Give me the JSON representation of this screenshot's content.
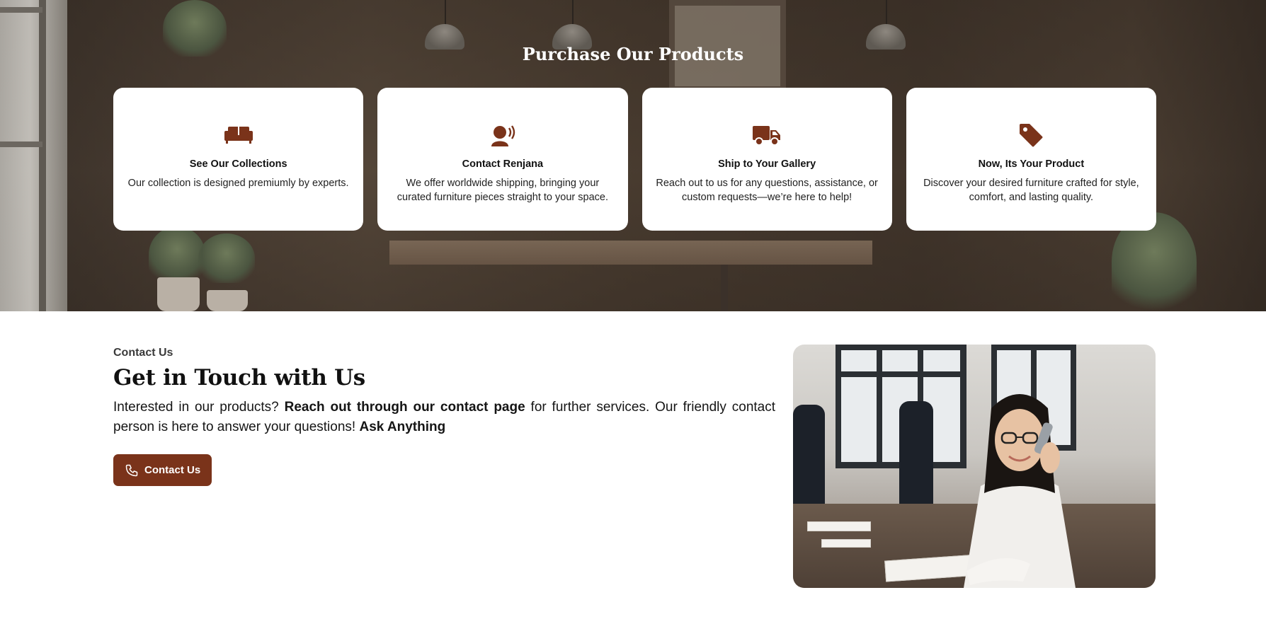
{
  "purchase": {
    "title": "Purchase Our Products",
    "cards": [
      {
        "icon": "sofa-icon",
        "title": "See Our Collections",
        "text": "Our collection is designed premiumly by experts."
      },
      {
        "icon": "speaking-person-icon",
        "title": "Contact Renjana",
        "text": "We offer worldwide shipping, bringing your curated furniture pieces straight to your space."
      },
      {
        "icon": "truck-icon",
        "title": "Ship to Your Gallery",
        "text": "Reach out to us for any questions, assistance, or custom requests—we’re here to help!"
      },
      {
        "icon": "tag-icon",
        "title": "Now, Its Your Product",
        "text": "Discover your desired furniture crafted for style, comfort, and lasting quality."
      }
    ]
  },
  "contact": {
    "eyebrow": "Contact Us",
    "heading": "Get in Touch with Us",
    "body_part1": "Interested in our products? ",
    "body_bold1": "Reach out through our contact page",
    "body_part2": " for further services. Our friendly contact person is here to answer your questions! ",
    "body_bold2": "Ask Anything",
    "button_label": "Contact Us",
    "button_icon": "phone-icon",
    "photo_subject": "woman-on-phone-photo"
  },
  "colors": {
    "accent": "#7a331a",
    "card_bg": "#ffffff",
    "hero_overlay": "#3d3128"
  }
}
